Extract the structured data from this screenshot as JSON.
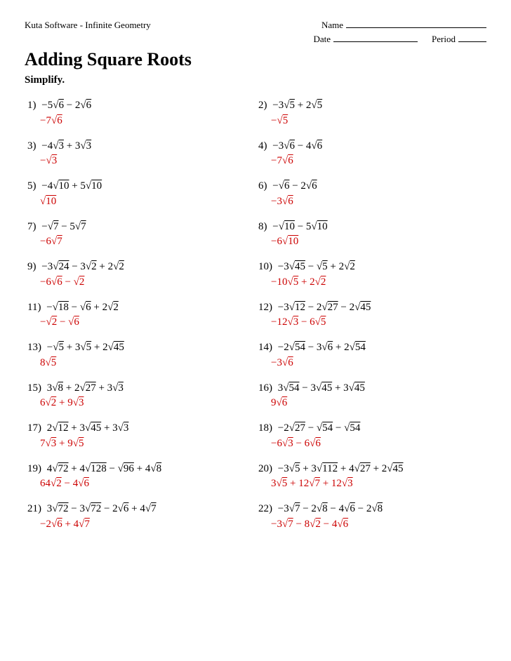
{
  "header": {
    "software": "Kuta Software - Infinite Geometry",
    "name_label": "Name",
    "date_label": "Date",
    "period_label": "Period"
  },
  "title": "Adding Square Roots",
  "instruction": "Simplify.",
  "problems": [
    {
      "num": "1)",
      "expr_html": "&minus;5&radic;<span style='text-decoration:overline'>6</span> &minus; 2&radic;<span style='text-decoration:overline'>6</span>",
      "answer_html": "&minus;7&radic;<span style='text-decoration:overline'>6</span>"
    },
    {
      "num": "2)",
      "expr_html": "&minus;3&radic;<span style='text-decoration:overline'>5</span> + 2&radic;<span style='text-decoration:overline'>5</span>",
      "answer_html": "&minus;&radic;<span style='text-decoration:overline'>5</span>"
    },
    {
      "num": "3)",
      "expr_html": "&minus;4&radic;<span style='text-decoration:overline'>3</span> + 3&radic;<span style='text-decoration:overline'>3</span>",
      "answer_html": "&minus;&radic;<span style='text-decoration:overline'>3</span>"
    },
    {
      "num": "4)",
      "expr_html": "&minus;3&radic;<span style='text-decoration:overline'>6</span> &minus; 4&radic;<span style='text-decoration:overline'>6</span>",
      "answer_html": "&minus;7&radic;<span style='text-decoration:overline'>6</span>"
    },
    {
      "num": "5)",
      "expr_html": "&minus;4&radic;<span style='text-decoration:overline'>10</span> + 5&radic;<span style='text-decoration:overline'>10</span>",
      "answer_html": "&radic;<span style='text-decoration:overline'>10</span>"
    },
    {
      "num": "6)",
      "expr_html": "&minus;&radic;<span style='text-decoration:overline'>6</span> &minus; 2&radic;<span style='text-decoration:overline'>6</span>",
      "answer_html": "&minus;3&radic;<span style='text-decoration:overline'>6</span>"
    },
    {
      "num": "7)",
      "expr_html": "&minus;&radic;<span style='text-decoration:overline'>7</span> &minus; 5&radic;<span style='text-decoration:overline'>7</span>",
      "answer_html": "&minus;6&radic;<span style='text-decoration:overline'>7</span>"
    },
    {
      "num": "8)",
      "expr_html": "&minus;&radic;<span style='text-decoration:overline'>10</span> &minus; 5&radic;<span style='text-decoration:overline'>10</span>",
      "answer_html": "&minus;6&radic;<span style='text-decoration:overline'>10</span>"
    },
    {
      "num": "9)",
      "expr_html": "&minus;3&radic;<span style='text-decoration:overline'>24</span> &minus; 3&radic;<span style='text-decoration:overline'>2</span> + 2&radic;<span style='text-decoration:overline'>2</span>",
      "answer_html": "&minus;6&radic;<span style='text-decoration:overline'>6</span> &minus; &radic;<span style='text-decoration:overline'>2</span>"
    },
    {
      "num": "10)",
      "expr_html": "&minus;3&radic;<span style='text-decoration:overline'>45</span> &minus; &radic;<span style='text-decoration:overline'>5</span> + 2&radic;<span style='text-decoration:overline'>2</span>",
      "answer_html": "&minus;10&radic;<span style='text-decoration:overline'>5</span> + 2&radic;<span style='text-decoration:overline'>2</span>"
    },
    {
      "num": "11)",
      "expr_html": "&minus;&radic;<span style='text-decoration:overline'>18</span> &minus; &radic;<span style='text-decoration:overline'>6</span> + 2&radic;<span style='text-decoration:overline'>2</span>",
      "answer_html": "&minus;&radic;<span style='text-decoration:overline'>2</span> &minus; &radic;<span style='text-decoration:overline'>6</span>"
    },
    {
      "num": "12)",
      "expr_html": "&minus;3&radic;<span style='text-decoration:overline'>12</span> &minus; 2&radic;<span style='text-decoration:overline'>27</span> &minus; 2&radic;<span style='text-decoration:overline'>45</span>",
      "answer_html": "&minus;12&radic;<span style='text-decoration:overline'>3</span> &minus; 6&radic;<span style='text-decoration:overline'>5</span>"
    },
    {
      "num": "13)",
      "expr_html": "&minus;&radic;<span style='text-decoration:overline'>5</span> + 3&radic;<span style='text-decoration:overline'>5</span> + 2&radic;<span style='text-decoration:overline'>45</span>",
      "answer_html": "8&radic;<span style='text-decoration:overline'>5</span>"
    },
    {
      "num": "14)",
      "expr_html": "&minus;2&radic;<span style='text-decoration:overline'>54</span> &minus; 3&radic;<span style='text-decoration:overline'>6</span> + 2&radic;<span style='text-decoration:overline'>54</span>",
      "answer_html": "&minus;3&radic;<span style='text-decoration:overline'>6</span>"
    },
    {
      "num": "15)",
      "expr_html": "3&radic;<span style='text-decoration:overline'>8</span> + 2&radic;<span style='text-decoration:overline'>27</span> + 3&radic;<span style='text-decoration:overline'>3</span>",
      "answer_html": "6&radic;<span style='text-decoration:overline'>2</span> + 9&radic;<span style='text-decoration:overline'>3</span>"
    },
    {
      "num": "16)",
      "expr_html": "3&radic;<span style='text-decoration:overline'>54</span> &minus; 3&radic;<span style='text-decoration:overline'>45</span> + 3&radic;<span style='text-decoration:overline'>45</span>",
      "answer_html": "9&radic;<span style='text-decoration:overline'>6</span>"
    },
    {
      "num": "17)",
      "expr_html": "2&radic;<span style='text-decoration:overline'>12</span> + 3&radic;<span style='text-decoration:overline'>45</span> + 3&radic;<span style='text-decoration:overline'>3</span>",
      "answer_html": "7&radic;<span style='text-decoration:overline'>3</span> + 9&radic;<span style='text-decoration:overline'>5</span>"
    },
    {
      "num": "18)",
      "expr_html": "&minus;2&radic;<span style='text-decoration:overline'>27</span> &minus; &radic;<span style='text-decoration:overline'>54</span> &minus; &radic;<span style='text-decoration:overline'>54</span>",
      "answer_html": "&minus;6&radic;<span style='text-decoration:overline'>3</span> &minus; 6&radic;<span style='text-decoration:overline'>6</span>"
    },
    {
      "num": "19)",
      "expr_html": "4&radic;<span style='text-decoration:overline'>72</span> + 4&radic;<span style='text-decoration:overline'>128</span> &minus; &radic;<span style='text-decoration:overline'>96</span> + 4&radic;<span style='text-decoration:overline'>8</span>",
      "answer_html": "64&radic;<span style='text-decoration:overline'>2</span> &minus; 4&radic;<span style='text-decoration:overline'>6</span>"
    },
    {
      "num": "20)",
      "expr_html": "&minus;3&radic;<span style='text-decoration:overline'>5</span> + 3&radic;<span style='text-decoration:overline'>112</span> + 4&radic;<span style='text-decoration:overline'>27</span> + 2&radic;<span style='text-decoration:overline'>45</span>",
      "answer_html": "3&radic;<span style='text-decoration:overline'>5</span> + 12&radic;<span style='text-decoration:overline'>7</span> + 12&radic;<span style='text-decoration:overline'>3</span>"
    },
    {
      "num": "21)",
      "expr_html": "3&radic;<span style='text-decoration:overline'>72</span> &minus; 3&radic;<span style='text-decoration:overline'>72</span> &minus; 2&radic;<span style='text-decoration:overline'>6</span> + 4&radic;<span style='text-decoration:overline'>7</span>",
      "answer_html": "&minus;2&radic;<span style='text-decoration:overline'>6</span> + 4&radic;<span style='text-decoration:overline'>7</span>"
    },
    {
      "num": "22)",
      "expr_html": "&minus;3&radic;<span style='text-decoration:overline'>7</span> &minus; 2&radic;<span style='text-decoration:overline'>8</span> &minus; 4&radic;<span style='text-decoration:overline'>6</span> &minus; 2&radic;<span style='text-decoration:overline'>8</span>",
      "answer_html": "&minus;3&radic;<span style='text-decoration:overline'>7</span> &minus; 8&radic;<span style='text-decoration:overline'>2</span> &minus; 4&radic;<span style='text-decoration:overline'>6</span>"
    }
  ]
}
